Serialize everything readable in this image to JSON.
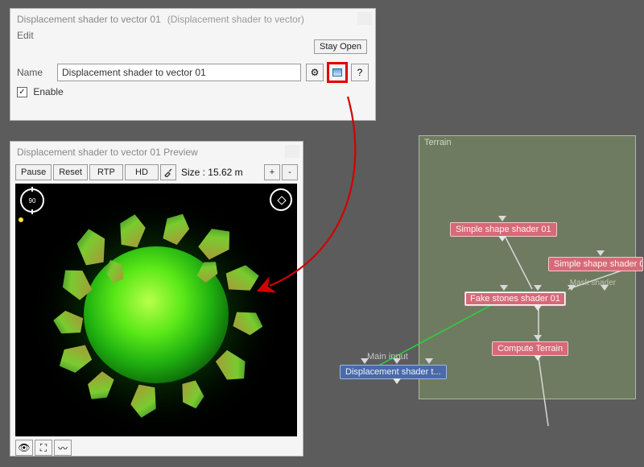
{
  "dialog": {
    "title": "Displacement shader to vector 01",
    "subtitle": "(Displacement shader to vector)",
    "menu_edit": "Edit",
    "stay_open": "Stay Open",
    "name_label": "Name",
    "name_value": "Displacement shader to vector 01",
    "enable_label": "Enable",
    "gear_icon": "⚙",
    "preview_icon": "▣",
    "help_icon": "?"
  },
  "preview": {
    "title": "Displacement shader to vector 01 Preview",
    "pause": "Pause",
    "reset": "Reset",
    "rtp": "RTP",
    "hd": "HD",
    "size_label": "Size : 15.62 m",
    "plus": "+",
    "minus": "-",
    "compass": "90",
    "eye": "👁",
    "fit": "⛶",
    "curve": "〰"
  },
  "graph": {
    "panel_title": "Terrain",
    "nodes": {
      "shape1": "Simple shape shader 01",
      "shape2": "Simple shape shader 0",
      "stones": "Fake stones shader 01",
      "compute": "Compute Terrain",
      "disp": "Displacement shader t..."
    },
    "mask_label": "Mask shader",
    "main_input": "Main input"
  }
}
